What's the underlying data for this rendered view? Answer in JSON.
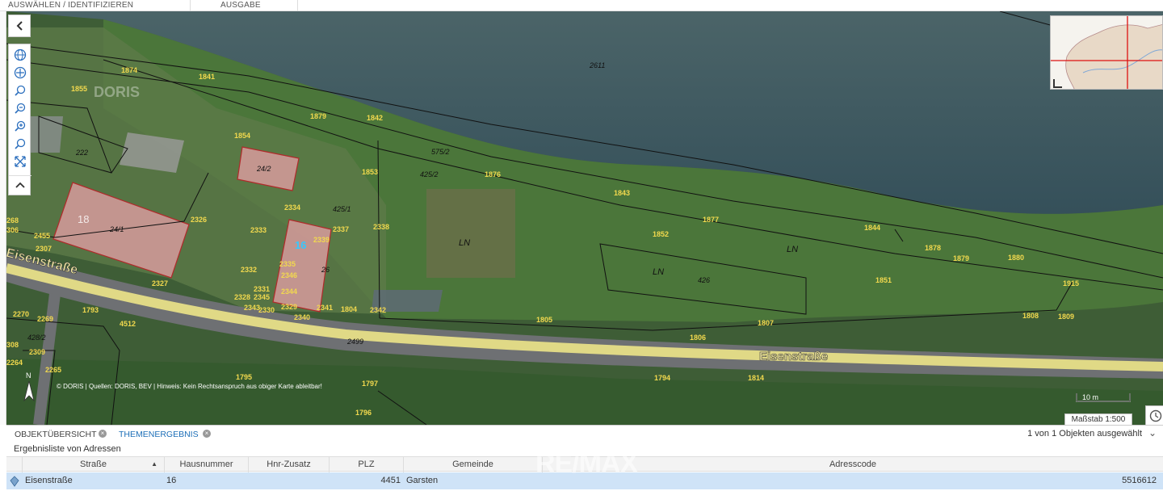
{
  "top_tabs": [
    "AUSWÄHLEN / IDENTIFIZIEREN",
    "AUSGABE"
  ],
  "toolbar_icons": [
    "globe-icon",
    "globe-nav-icon",
    "zoom-in-icon",
    "zoom-out-icon",
    "zoom-region-icon",
    "zoom-back-icon",
    "full-extent-icon",
    "chevron-up-icon"
  ],
  "map": {
    "logo_text": "DORIS",
    "road_labels": [
      "Eisenstraße",
      "Eisenstraße"
    ],
    "attribution": "© DORIS | Quellen: DORIS, BEV | Hinweis: Kein Rechtsanspruch aus obiger Karte ableitbar!",
    "north_label": "N",
    "land_use_labels": [
      "LN",
      "LN",
      "LN"
    ],
    "house_numbers": [
      "18",
      "16"
    ],
    "parcel_numbers_yellow": [
      "1874",
      "1841",
      "1855",
      "1879",
      "1842",
      "1854",
      "1853",
      "1876",
      "1843",
      "1877",
      "1844",
      "1852",
      "1878",
      "1879",
      "1880",
      "1851",
      "1915",
      "1808",
      "1809",
      "1807",
      "1806",
      "1805",
      "1804",
      "1794",
      "1814",
      "1797",
      "1796",
      "1795",
      "1793",
      "2326",
      "2327",
      "2334",
      "2333",
      "2337",
      "2338",
      "2339",
      "2335",
      "2332",
      "2346",
      "2331",
      "2344",
      "2328",
      "2345",
      "2343",
      "2330",
      "2329",
      "2341",
      "2342",
      "2340",
      "2455",
      "2307",
      "2270",
      "2269",
      "2309",
      "2265",
      "2264",
      "4512",
      "268",
      "306",
      "308"
    ],
    "parcel_numbers_black": [
      "2611",
      "222",
      "24/2",
      "24/1",
      "425/1",
      "425/2",
      "575/2",
      "26",
      "426",
      "2499",
      "428/2"
    ]
  },
  "scale": {
    "bar_label": "10 m",
    "label": "Maßstab 1:500"
  },
  "bottom": {
    "tabs": [
      {
        "label": "OBJEKTÜBERSICHT",
        "active": false
      },
      {
        "label": "THEMENERGEBNIS",
        "active": true
      }
    ],
    "count_text": "1 von 1 Objekten ausgewählt",
    "subtitle": "Ergebnisliste von Adressen",
    "columns": [
      "Straße",
      "Hausnummer",
      "Hnr-Zusatz",
      "PLZ",
      "Gemeinde",
      "Adresscode"
    ],
    "rows": [
      {
        "strasse": "Eisenstraße",
        "hausnummer": "16",
        "hnr_zusatz": "",
        "plz": "4451",
        "gemeinde": "Garsten",
        "adresscode": "5516612"
      }
    ],
    "watermark": "RE/MAX"
  },
  "colors": {
    "accent": "#1d6fb8",
    "parcel_label": "#f2d94e",
    "building_fill": "#e8a0a8",
    "road_highlight": "#f5eb8a",
    "water": "#3f5860",
    "row_selected": "#cfe3f7"
  }
}
